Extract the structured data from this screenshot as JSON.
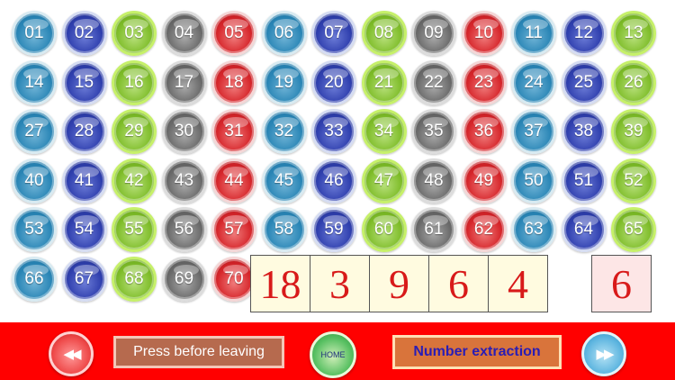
{
  "balls": [
    {
      "label": "01",
      "color": "teal"
    },
    {
      "label": "02",
      "color": "navy"
    },
    {
      "label": "03",
      "color": "green"
    },
    {
      "label": "04",
      "color": "gray"
    },
    {
      "label": "05",
      "color": "red"
    },
    {
      "label": "06",
      "color": "teal"
    },
    {
      "label": "07",
      "color": "navy"
    },
    {
      "label": "08",
      "color": "green"
    },
    {
      "label": "09",
      "color": "gray"
    },
    {
      "label": "10",
      "color": "red"
    },
    {
      "label": "11",
      "color": "teal"
    },
    {
      "label": "12",
      "color": "navy"
    },
    {
      "label": "13",
      "color": "green"
    },
    {
      "label": "14",
      "color": "teal"
    },
    {
      "label": "15",
      "color": "navy"
    },
    {
      "label": "16",
      "color": "green"
    },
    {
      "label": "17",
      "color": "gray"
    },
    {
      "label": "18",
      "color": "red"
    },
    {
      "label": "19",
      "color": "teal"
    },
    {
      "label": "20",
      "color": "navy"
    },
    {
      "label": "21",
      "color": "green"
    },
    {
      "label": "22",
      "color": "gray"
    },
    {
      "label": "23",
      "color": "red"
    },
    {
      "label": "24",
      "color": "teal"
    },
    {
      "label": "25",
      "color": "navy"
    },
    {
      "label": "26",
      "color": "green"
    },
    {
      "label": "27",
      "color": "teal"
    },
    {
      "label": "28",
      "color": "navy"
    },
    {
      "label": "29",
      "color": "green"
    },
    {
      "label": "30",
      "color": "gray"
    },
    {
      "label": "31",
      "color": "red"
    },
    {
      "label": "32",
      "color": "teal"
    },
    {
      "label": "33",
      "color": "navy"
    },
    {
      "label": "34",
      "color": "green"
    },
    {
      "label": "35",
      "color": "gray"
    },
    {
      "label": "36",
      "color": "red"
    },
    {
      "label": "37",
      "color": "teal"
    },
    {
      "label": "38",
      "color": "navy"
    },
    {
      "label": "39",
      "color": "green"
    },
    {
      "label": "40",
      "color": "teal"
    },
    {
      "label": "41",
      "color": "navy"
    },
    {
      "label": "42",
      "color": "green"
    },
    {
      "label": "43",
      "color": "gray"
    },
    {
      "label": "44",
      "color": "red"
    },
    {
      "label": "45",
      "color": "teal"
    },
    {
      "label": "46",
      "color": "navy"
    },
    {
      "label": "47",
      "color": "green"
    },
    {
      "label": "48",
      "color": "gray"
    },
    {
      "label": "49",
      "color": "red"
    },
    {
      "label": "50",
      "color": "teal"
    },
    {
      "label": "51",
      "color": "navy"
    },
    {
      "label": "52",
      "color": "green"
    },
    {
      "label": "53",
      "color": "teal"
    },
    {
      "label": "54",
      "color": "navy"
    },
    {
      "label": "55",
      "color": "green"
    },
    {
      "label": "56",
      "color": "gray"
    },
    {
      "label": "57",
      "color": "red"
    },
    {
      "label": "58",
      "color": "teal"
    },
    {
      "label": "59",
      "color": "navy"
    },
    {
      "label": "60",
      "color": "green"
    },
    {
      "label": "61",
      "color": "gray"
    },
    {
      "label": "62",
      "color": "red"
    },
    {
      "label": "63",
      "color": "teal"
    },
    {
      "label": "64",
      "color": "navy"
    },
    {
      "label": "65",
      "color": "green"
    },
    {
      "label": "66",
      "color": "teal"
    },
    {
      "label": "67",
      "color": "navy"
    },
    {
      "label": "68",
      "color": "green"
    },
    {
      "label": "69",
      "color": "gray"
    },
    {
      "label": "70",
      "color": "red"
    }
  ],
  "drawn_numbers": [
    "18",
    "3",
    "9",
    "6",
    "4"
  ],
  "current_number": "6",
  "footer": {
    "prev_icon": "rewind-icon",
    "prev_glyph": "◀◀",
    "leave_label": "Press before leaving",
    "home_label": "HOME",
    "extract_label": "Number extraction",
    "next_icon": "fast-forward-icon",
    "next_glyph": "▶▶",
    "background": "#ff0000"
  },
  "colors": {
    "teal": "#2a86b6",
    "navy": "#2f3fae",
    "green": "#7fbd2a",
    "gray": "#6a6a6a",
    "red": "#d6262b",
    "draw_text": "#d81a1a"
  }
}
